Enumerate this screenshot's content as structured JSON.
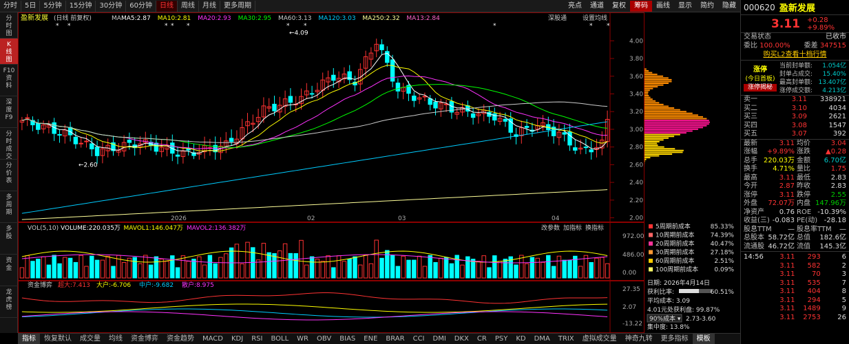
{
  "periods": [
    "分时",
    "5日",
    "5分钟",
    "15分钟",
    "30分钟",
    "60分钟",
    "日线",
    "周线",
    "月线",
    "更多周期"
  ],
  "active_period": "日线",
  "toolbar": [
    "亮点",
    "通道",
    "复权",
    "筹码",
    "画线",
    "显示",
    "简约",
    "隐藏"
  ],
  "left_nav": [
    "分时图",
    "K线图",
    "F10资料",
    "深度F9",
    "分时成交",
    "分价表",
    "多周期",
    "多股",
    "资金",
    "龙虎榜"
  ],
  "main_legend": {
    "name": "盈新发展",
    "sub": "(日线 前复权)",
    "ma": [
      {
        "label": "MA5:2.87",
        "color": "#ffffff"
      },
      {
        "label": "MA10:2.81",
        "color": "#ffff00"
      },
      {
        "label": "MA20:2.93",
        "color": "#ff33ff"
      },
      {
        "label": "MA30:2.95",
        "color": "#00ff00"
      },
      {
        "label": "MA60:3.13",
        "color": "#cccccc"
      },
      {
        "label": "MA120:3.03",
        "color": "#00ccff"
      },
      {
        "label": "MA250:2.32",
        "color": "#ffff99"
      },
      {
        "label": "MA13:2.84",
        "color": "#ff66cc"
      }
    ],
    "right_links": [
      "深股通",
      "设置均线"
    ]
  },
  "price_axis": [
    "4.00",
    "3.80",
    "3.60",
    "3.40",
    "3.20",
    "3.00",
    "2.80",
    "2.60",
    "2.40",
    "2.20",
    "2.00"
  ],
  "annotations": {
    "high": "4.09",
    "low": "2.60"
  },
  "vol_legend": {
    "title": "VOL(5,10)",
    "items": [
      {
        "label": "VOLUME:220.035万",
        "color": "#ffffff"
      },
      {
        "label": "MAVOL1:146.047万",
        "color": "#ffff00"
      },
      {
        "label": "MAVOL2:136.382万",
        "color": "#ff33ff"
      }
    ],
    "links": [
      "改参数",
      "加指标",
      "换指标"
    ],
    "axis": [
      "972.00",
      "486.00",
      "0.00"
    ]
  },
  "fund_legend": {
    "title": "资金博弈",
    "items": [
      {
        "label": "超大:7.413",
        "color": "#ff3333"
      },
      {
        "label": "大户:-6.706",
        "color": "#ffff00"
      },
      {
        "label": "中户:-9.682",
        "color": "#00ccff"
      },
      {
        "label": "散户:8.975",
        "color": "#ff33ff"
      }
    ],
    "axis": [
      "27.35",
      "2.07",
      "-13.22"
    ]
  },
  "date_axis": [
    "2026",
    "02",
    "03",
    "04"
  ],
  "chip_legend": [
    {
      "label": "5周期前成本",
      "value": "85.33%",
      "color": "#ff3333"
    },
    {
      "label": "10周期前成本",
      "value": "74.39%",
      "color": "#ff6666"
    },
    {
      "label": "20周期前成本",
      "value": "40.47%",
      "color": "#ff3399"
    },
    {
      "label": "30周期前成本",
      "value": "27.18%",
      "color": "#ff9933"
    },
    {
      "label": "60周期前成本",
      "value": "2.51%",
      "color": "#ffcc00"
    },
    {
      "label": "100周期前成本",
      "value": "0.09%",
      "color": "#ffff66"
    }
  ],
  "chip_info": {
    "date": "日期: 2026年4月14日",
    "profit_ratio_label": "获利比率:",
    "profit_ratio": "60.51%",
    "avg_cost": "平均成本: 3.09",
    "profit_at": "4.01元处获利盘: 99.87%",
    "range_select": "90%成本",
    "range": "2.73-3.60",
    "concentration": "集中度: 13.8%"
  },
  "bottom_tabs": [
    "指标",
    "恢复默认",
    "成交量",
    "均线",
    "资金博弈",
    "资金趋势",
    "MACD",
    "KDJ",
    "RSI",
    "BOLL",
    "WR",
    "OBV",
    "BIAS",
    "ENE",
    "BRAR",
    "CCI",
    "DMI",
    "DKX",
    "CR",
    "PSY",
    "KD",
    "DMA",
    "TRIX",
    "虚拟成交量",
    "神奇九转",
    "更多指标",
    "模板"
  ],
  "stock": {
    "code": "000620",
    "name": "盈新发展",
    "price": "3.11",
    "change": "+0.28",
    "pct": "+9.89%",
    "status_label": "交易状态",
    "status": "已收市",
    "weibi_label": "委比",
    "weibi": "100.00%",
    "weicha_label": "委差",
    "weicha": "347515",
    "l2_link": "购买L2查看十档行情",
    "limit_title": "涨停",
    "limit_sub": "(今日首板)",
    "limit_btn": "涨停揭秘",
    "limit_info": [
      {
        "k": "当前封单额:",
        "v": "1.054亿"
      },
      {
        "k": "封单占成交:",
        "v": "15.40%"
      },
      {
        "k": "最高封单额:",
        "v": "13.407亿"
      },
      {
        "k": "涨停成交额:",
        "v": "4.213亿"
      }
    ],
    "asks": [
      {
        "k": "卖一",
        "p": "3.11",
        "v": "338921"
      },
      {
        "k": "买二",
        "p": "3.10",
        "v": "4034"
      },
      {
        "k": "买三",
        "p": "3.09",
        "v": "2621"
      },
      {
        "k": "买四",
        "p": "3.08",
        "v": "1547"
      },
      {
        "k": "买五",
        "p": "3.07",
        "v": "392"
      }
    ],
    "stats": [
      {
        "k1": "最新",
        "v1": "3.11",
        "c1": "red",
        "k2": "均价",
        "v2": "3.04",
        "c2": "red"
      },
      {
        "k1": "涨幅",
        "v1": "+9.89%",
        "c1": "red",
        "k2": "涨跌",
        "v2": "▲0.28",
        "c2": "red"
      },
      {
        "k1": "总手",
        "v1": "220.03万",
        "c1": "yellow",
        "k2": "金额",
        "v2": "6.70亿",
        "c2": "cyan"
      },
      {
        "k1": "换手",
        "v1": "4.71%",
        "c1": "yellow",
        "k2": "量比",
        "v2": "1.75",
        "c2": "red"
      },
      {
        "k1": "最高",
        "v1": "3.11",
        "c1": "red",
        "k2": "最低",
        "v2": "2.83",
        "c2": "white"
      },
      {
        "k1": "今开",
        "v1": "2.87",
        "c1": "red",
        "k2": "昨收",
        "v2": "2.83",
        "c2": "white"
      },
      {
        "k1": "涨停",
        "v1": "3.11",
        "c1": "red",
        "k2": "跌停",
        "v2": "2.55",
        "c2": "green"
      },
      {
        "k1": "外盘",
        "v1": "72.07万",
        "c1": "red",
        "k2": "内盘",
        "v2": "147.96万",
        "c2": "green"
      },
      {
        "k1": "净资产",
        "v1": "0.76",
        "c1": "white",
        "k2": "ROE",
        "v2": "-10.39%",
        "c2": "white"
      },
      {
        "k1": "收益(三)",
        "v1": "-0.083",
        "c1": "white",
        "k2": "PE(动)",
        "v2": "-28.18",
        "c2": "white"
      },
      {
        "k1": "股息TTM",
        "v1": "—",
        "c1": "white",
        "k2": "股息率TTM",
        "v2": "—",
        "c2": "white"
      },
      {
        "k1": "总股本",
        "v1": "58.72亿",
        "c1": "white",
        "k2": "总值",
        "v2": "182.6亿",
        "c2": "white"
      },
      {
        "k1": "流通股",
        "v1": "46.72亿",
        "c1": "white",
        "k2": "流值",
        "v2": "145.3亿",
        "c2": "white"
      }
    ],
    "ticks": [
      {
        "t": "14:56",
        "p": "3.11",
        "v": "293",
        "n": "6"
      },
      {
        "t": "",
        "p": "3.11",
        "v": "582",
        "n": "2"
      },
      {
        "t": "",
        "p": "3.11",
        "v": "70",
        "n": "3"
      },
      {
        "t": "",
        "p": "3.11",
        "v": "535",
        "n": "7"
      },
      {
        "t": "",
        "p": "3.11",
        "v": "404",
        "n": "8"
      },
      {
        "t": "",
        "p": "3.11",
        "v": "294",
        "n": "5"
      },
      {
        "t": "",
        "p": "3.11",
        "v": "1489",
        "n": "9"
      },
      {
        "t": "",
        "p": "3.11",
        "v": "2753",
        "n": "26"
      }
    ]
  }
}
